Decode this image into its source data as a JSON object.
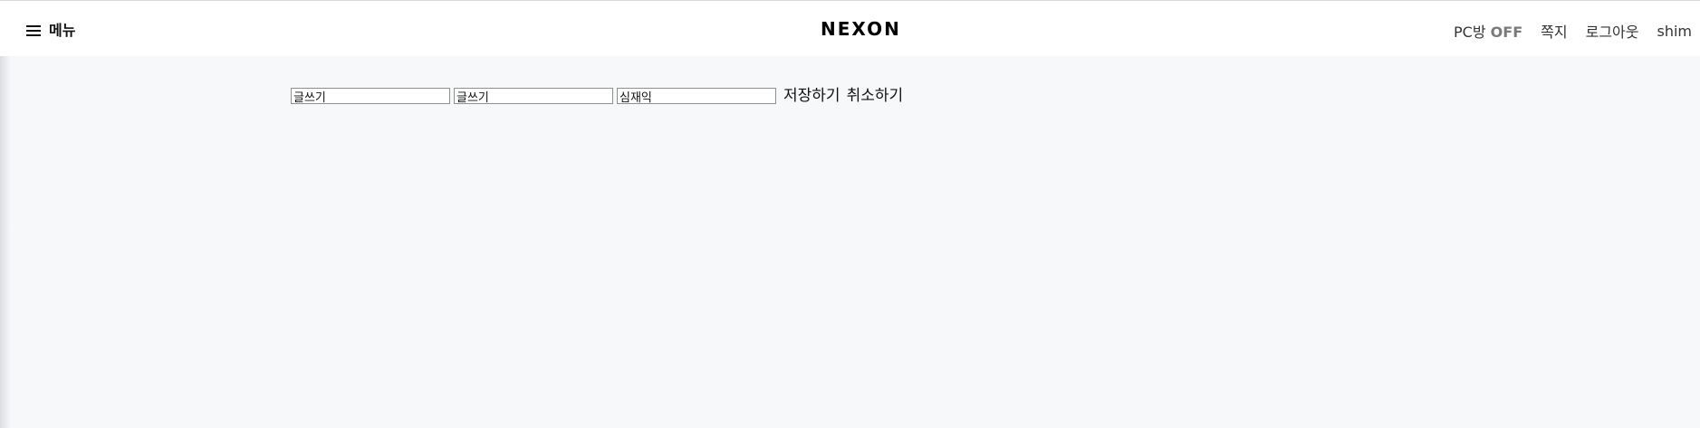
{
  "header": {
    "menu_label": "메뉴",
    "logo_text": "NEXON",
    "nav": {
      "pc_prefix": "PC방",
      "pc_status": "OFF",
      "messages_label": "쪽지",
      "logout_label": "로그아웃",
      "username": "shim"
    }
  },
  "form": {
    "title_value": "글쓰기",
    "content_value": "글쓰기",
    "author_value": "심재익",
    "save_label": "저장하기",
    "cancel_label": "취소하기"
  },
  "icons": {
    "menu": "hamburger-menu-icon"
  }
}
